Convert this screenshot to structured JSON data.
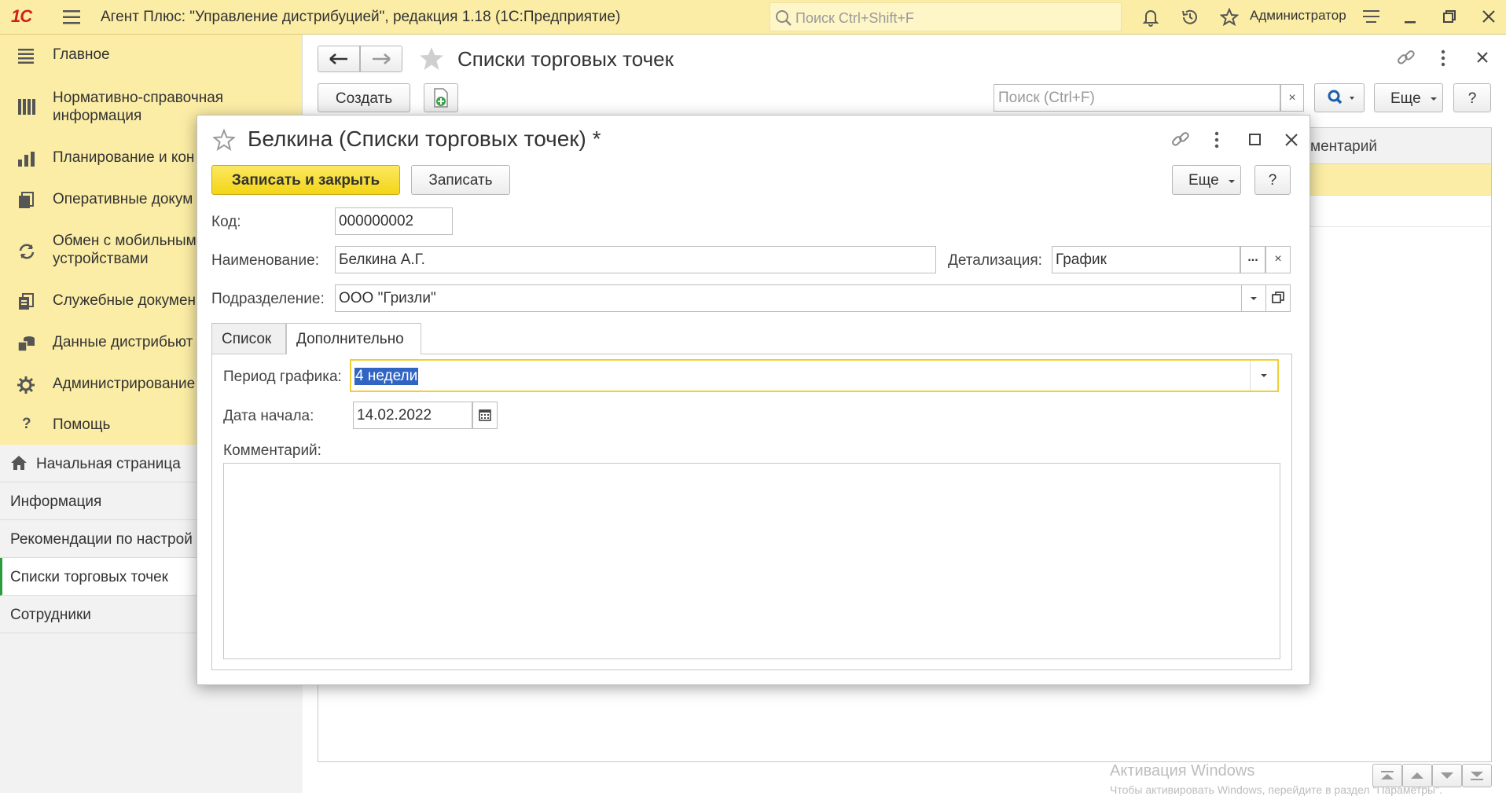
{
  "app": {
    "logo": "1С",
    "title": "Агент Плюс: \"Управление дистрибуцией\", редакция 1.18  (1С:Предприятие)",
    "search_placeholder": "Поиск Ctrl+Shift+F",
    "user": "Администратор"
  },
  "sections": [
    {
      "label": "Главное",
      "icon": "menu-icon"
    },
    {
      "label": "Нормативно-справочная\nинформация",
      "icon": "reference-icon"
    },
    {
      "label": "Планирование и кон",
      "icon": "planning-icon"
    },
    {
      "label": "Оперативные докум",
      "icon": "documents-icon"
    },
    {
      "label": "Обмен с мобильным\nустройствами",
      "icon": "sync-icon"
    },
    {
      "label": "Служебные докумен",
      "icon": "service-docs-icon"
    },
    {
      "label": "Данные дистрибьют",
      "icon": "distributor-icon"
    },
    {
      "label": "Администрирование",
      "icon": "gear-icon"
    },
    {
      "label": "Помощь",
      "icon": "help-icon"
    }
  ],
  "open_windows": [
    {
      "label": "Начальная страница",
      "icon": "home-icon"
    },
    {
      "label": "Информация"
    },
    {
      "label": "Рекомендации по настрой"
    },
    {
      "label": "Списки торговых точек",
      "active": true
    },
    {
      "label": "Сотрудники"
    }
  ],
  "list_form": {
    "title": "Списки торговых точек",
    "create_label": "Создать",
    "search_placeholder": "Поиск (Ctrl+F)",
    "more_label": "Еще",
    "help_label": "?",
    "column_comment": "ментарий"
  },
  "dialog": {
    "title": "Белкина (Списки торговых точек) *",
    "save_close_label": "Записать и закрыть",
    "save_label": "Записать",
    "more_label": "Еще",
    "help_label": "?",
    "code_label": "Код:",
    "code_value": "000000002",
    "name_label": "Наименование:",
    "name_value": "Белкина А.Г.",
    "detail_label": "Детализация:",
    "detail_value": "График",
    "division_label": "Подразделение:",
    "division_value": "ООО \"Гризли\"",
    "tabs": [
      "Список",
      "Дополнительно"
    ],
    "period_label": "Период графика:",
    "period_value": "4 недели",
    "start_label": "Дата начала:",
    "start_value": "14.02.2022",
    "comment_label": "Комментарий:",
    "dots_label": "...",
    "clear_label": "×"
  },
  "watermark": {
    "line1": "Активация Windows",
    "line2": "Чтобы активировать Windows, перейдите в раздел \"Параметры\"."
  }
}
